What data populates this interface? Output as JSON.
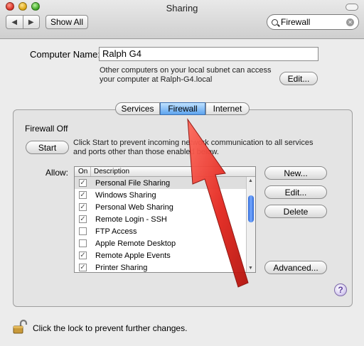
{
  "window": {
    "title": "Sharing"
  },
  "toolbar": {
    "show_all_label": "Show All",
    "search_value": "Firewall",
    "back_icon": "left-arrow-icon",
    "forward_icon": "right-arrow-icon"
  },
  "computer": {
    "label": "Computer Name:",
    "value": "Ralph G4",
    "note_line1": "Other computers on your local subnet can access",
    "note_line2": "your computer at Ralph-G4.local",
    "edit_label": "Edit..."
  },
  "tabs": [
    "Services",
    "Firewall",
    "Internet"
  ],
  "firewall": {
    "status": "Firewall Off",
    "start_label": "Start",
    "description": "Click Start to prevent incoming network communication to all services and ports other than those enabled below."
  },
  "allow": {
    "label": "Allow:",
    "columns": [
      "On",
      "Description"
    ],
    "rows": [
      {
        "label": "Personal File Sharing",
        "checked": true
      },
      {
        "label": "Windows Sharing",
        "checked": true
      },
      {
        "label": "Personal Web Sharing",
        "checked": true
      },
      {
        "label": "Remote Login - SSH",
        "checked": true
      },
      {
        "label": "FTP Access",
        "checked": false
      },
      {
        "label": "Apple Remote Desktop",
        "checked": false
      },
      {
        "label": "Remote Apple Events",
        "checked": true
      },
      {
        "label": "Printer Sharing",
        "checked": true
      }
    ]
  },
  "actions": {
    "new": "New...",
    "edit": "Edit...",
    "delete": "Delete",
    "advanced": "Advanced..."
  },
  "footer": {
    "lock_text": "Click the lock to prevent further changes.",
    "help": "?"
  },
  "colors": {
    "selected_tab": "#5da3ee",
    "arrow": "#e3261e"
  }
}
